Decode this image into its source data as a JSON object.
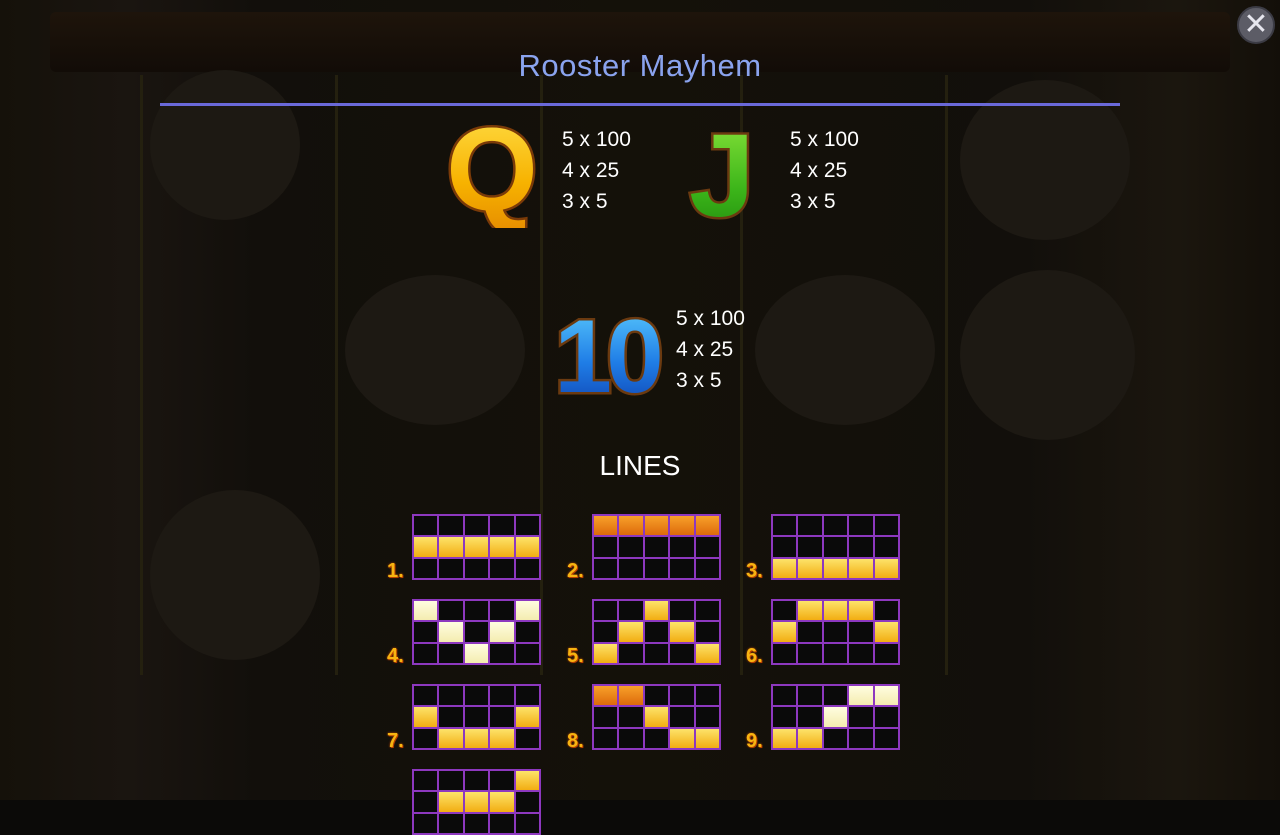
{
  "title": "Rooster Mayhem",
  "close_icon": "close-icon",
  "symbols": [
    {
      "glyph": "Q",
      "payouts": [
        "5 x 100",
        "4 x 25",
        "3 x 5"
      ],
      "color": "#f6b400"
    },
    {
      "glyph": "J",
      "payouts": [
        "5 x 100",
        "4 x 25",
        "3 x 5"
      ],
      "color": "#3fbf1f"
    },
    {
      "glyph": "10",
      "payouts": [
        "5 x 100",
        "4 x 25",
        "3 x 5"
      ],
      "color": "#1f7de6"
    }
  ],
  "lines_heading": "LINES",
  "lines": [
    {
      "label": "1.",
      "cells": [
        [
          0,
          0,
          0,
          0,
          0
        ],
        [
          1,
          1,
          1,
          1,
          1
        ],
        [
          0,
          0,
          0,
          0,
          0
        ]
      ]
    },
    {
      "label": "2.",
      "cells": [
        [
          1,
          1,
          1,
          1,
          1
        ],
        [
          0,
          0,
          0,
          0,
          0
        ],
        [
          0,
          0,
          0,
          0,
          0
        ]
      ]
    },
    {
      "label": "3.",
      "cells": [
        [
          0,
          0,
          0,
          0,
          0
        ],
        [
          0,
          0,
          0,
          0,
          0
        ],
        [
          1,
          1,
          1,
          1,
          1
        ]
      ]
    },
    {
      "label": "4.",
      "cells": [
        [
          1,
          0,
          0,
          0,
          1
        ],
        [
          0,
          1,
          0,
          1,
          0
        ],
        [
          0,
          0,
          1,
          0,
          0
        ]
      ]
    },
    {
      "label": "5.",
      "cells": [
        [
          0,
          0,
          1,
          0,
          0
        ],
        [
          0,
          1,
          0,
          1,
          0
        ],
        [
          1,
          0,
          0,
          0,
          1
        ]
      ]
    },
    {
      "label": "6.",
      "cells": [
        [
          0,
          1,
          1,
          1,
          0
        ],
        [
          1,
          0,
          0,
          0,
          1
        ],
        [
          0,
          0,
          0,
          0,
          0
        ]
      ]
    },
    {
      "label": "7.",
      "cells": [
        [
          0,
          0,
          0,
          0,
          0
        ],
        [
          1,
          0,
          0,
          0,
          1
        ],
        [
          0,
          1,
          1,
          1,
          0
        ]
      ]
    },
    {
      "label": "8.",
      "cells": [
        [
          1,
          1,
          0,
          0,
          0
        ],
        [
          0,
          0,
          1,
          0,
          0
        ],
        [
          0,
          0,
          0,
          1,
          1
        ]
      ]
    },
    {
      "label": "9.",
      "cells": [
        [
          0,
          0,
          0,
          1,
          1
        ],
        [
          0,
          0,
          1,
          0,
          0
        ],
        [
          1,
          1,
          0,
          0,
          0
        ]
      ]
    },
    {
      "label": "",
      "cells": [
        [
          0,
          0,
          0,
          0,
          1
        ],
        [
          0,
          1,
          1,
          1,
          0
        ],
        [
          0,
          0,
          0,
          0,
          0
        ]
      ]
    }
  ],
  "colors": {
    "accent": "#8aa3ee",
    "grid_border": "#8d38bf",
    "line_number": "#f7b411"
  }
}
